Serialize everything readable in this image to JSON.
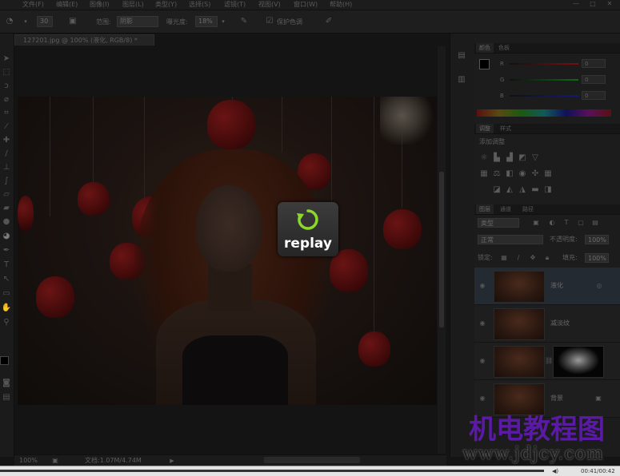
{
  "menu": [
    "文件(F)",
    "编辑(E)",
    "图像(I)",
    "图层(L)",
    "类型(Y)",
    "选择(S)",
    "滤镜(T)",
    "视图(V)",
    "窗口(W)",
    "帮助(H)"
  ],
  "window_controls": [
    "—",
    "□",
    "✕"
  ],
  "options": {
    "brush_size": "30",
    "range_label": "范围:",
    "range_value": "阴影",
    "exposure_label": "曝光度:",
    "exposure_value": "18%",
    "protect_tones": "保护色调"
  },
  "document_tab": "127201.jpg @ 100% (液化, RGB/8) *",
  "replay_label": "replay",
  "status": {
    "zoom": "100%",
    "doc_info": "文档:1.07M/4.74M"
  },
  "color_panel": {
    "tabs": [
      "颜色",
      "色板"
    ],
    "channels": [
      {
        "name": "R",
        "value": "0",
        "color": "#7a1010"
      },
      {
        "name": "G",
        "value": "0",
        "color": "#0d6a14"
      },
      {
        "name": "B",
        "value": "0",
        "color": "#121a7a"
      }
    ]
  },
  "adjust_panel": {
    "tabs": [
      "调整",
      "样式"
    ],
    "title": "添加调整"
  },
  "layers_panel": {
    "tabs": [
      "图层",
      "通道",
      "路径"
    ],
    "kind_label": "类型",
    "blend_mode": "正常",
    "opacity_label": "不透明度:",
    "opacity_value": "100%",
    "lock_label": "锁定:",
    "fill_label": "填充:",
    "fill_value": "100%",
    "layers": [
      {
        "name": "液化",
        "selected": true
      },
      {
        "name": "减淡纹",
        "selected": false
      },
      {
        "name": "",
        "selected": false,
        "has_mask": true
      },
      {
        "name": "背景",
        "selected": false
      }
    ]
  },
  "playback": {
    "time": "00:41/00:42"
  },
  "watermark": {
    "text": "机电教程图",
    "url": "www.jdjcy.com"
  }
}
